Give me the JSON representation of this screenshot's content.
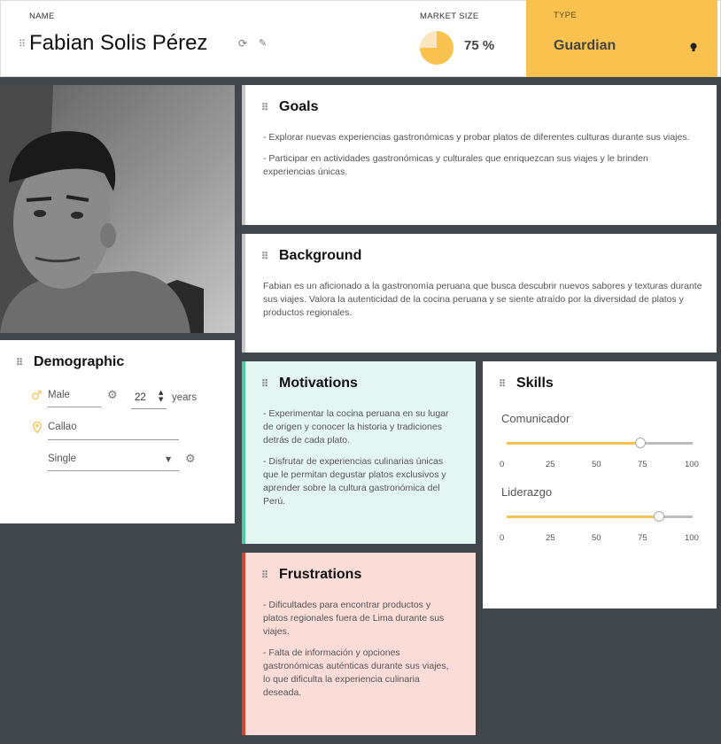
{
  "header": {
    "name_label": "NAME",
    "name": "Fabian Solis Pérez",
    "market_size_label": "MARKET SIZE",
    "market_size": "75 %",
    "market_size_value": 75,
    "type_label": "TYPE",
    "type": "Guardian"
  },
  "goals": {
    "title": "Goals",
    "items": [
      "- Explorar nuevas experiencias gastronómicas y probar platos de diferentes culturas durante sus viajes.",
      "- Participar en actividades gastronómicas y culturales que enriquezcan sus viajes y le brinden experiencias únicas."
    ]
  },
  "background": {
    "title": "Background",
    "text": "Fabian es un aficionado a la gastronomía peruana que busca descubrir nuevos sabores y texturas durante sus viajes. Valora la autenticidad de la cocina peruana y se siente atraído por la diversidad de platos y productos regionales."
  },
  "demographic": {
    "title": "Demographic",
    "gender": "Male",
    "age": "22",
    "age_unit": "years",
    "location": "Callao",
    "status": "Single"
  },
  "motivations": {
    "title": "Motivations",
    "items": [
      "- Experimentar la cocina peruana en su lugar de origen y conocer la historia y tradiciones detrás de cada plato.",
      "- Disfrutar de experiencias culinarias únicas que le permitan degustar platos exclusivos y aprender sobre la cultura gastronómica del Perú."
    ]
  },
  "frustrations": {
    "title": "Frustrations",
    "items": [
      "- Dificultades para encontrar productos y platos regionales fuera de Lima durante sus viajes.",
      "- Falta de información y opciones gastronómicas auténticas durante sus viajes, lo que dificulta la experiencia culinaria deseada."
    ]
  },
  "skills": {
    "title": "Skills",
    "ticks": [
      "0",
      "25",
      "50",
      "75",
      "100"
    ],
    "items": [
      {
        "label": "Comunicador",
        "value": 72
      },
      {
        "label": "Liderazgo",
        "value": 82
      }
    ]
  },
  "colors": {
    "accent": "#f9c24f",
    "motivations_bg": "#e3f6f1",
    "motivations_border": "#4ecb9a",
    "frustrations_bg": "#fbdcd7",
    "frustrations_border": "#d9432e"
  }
}
